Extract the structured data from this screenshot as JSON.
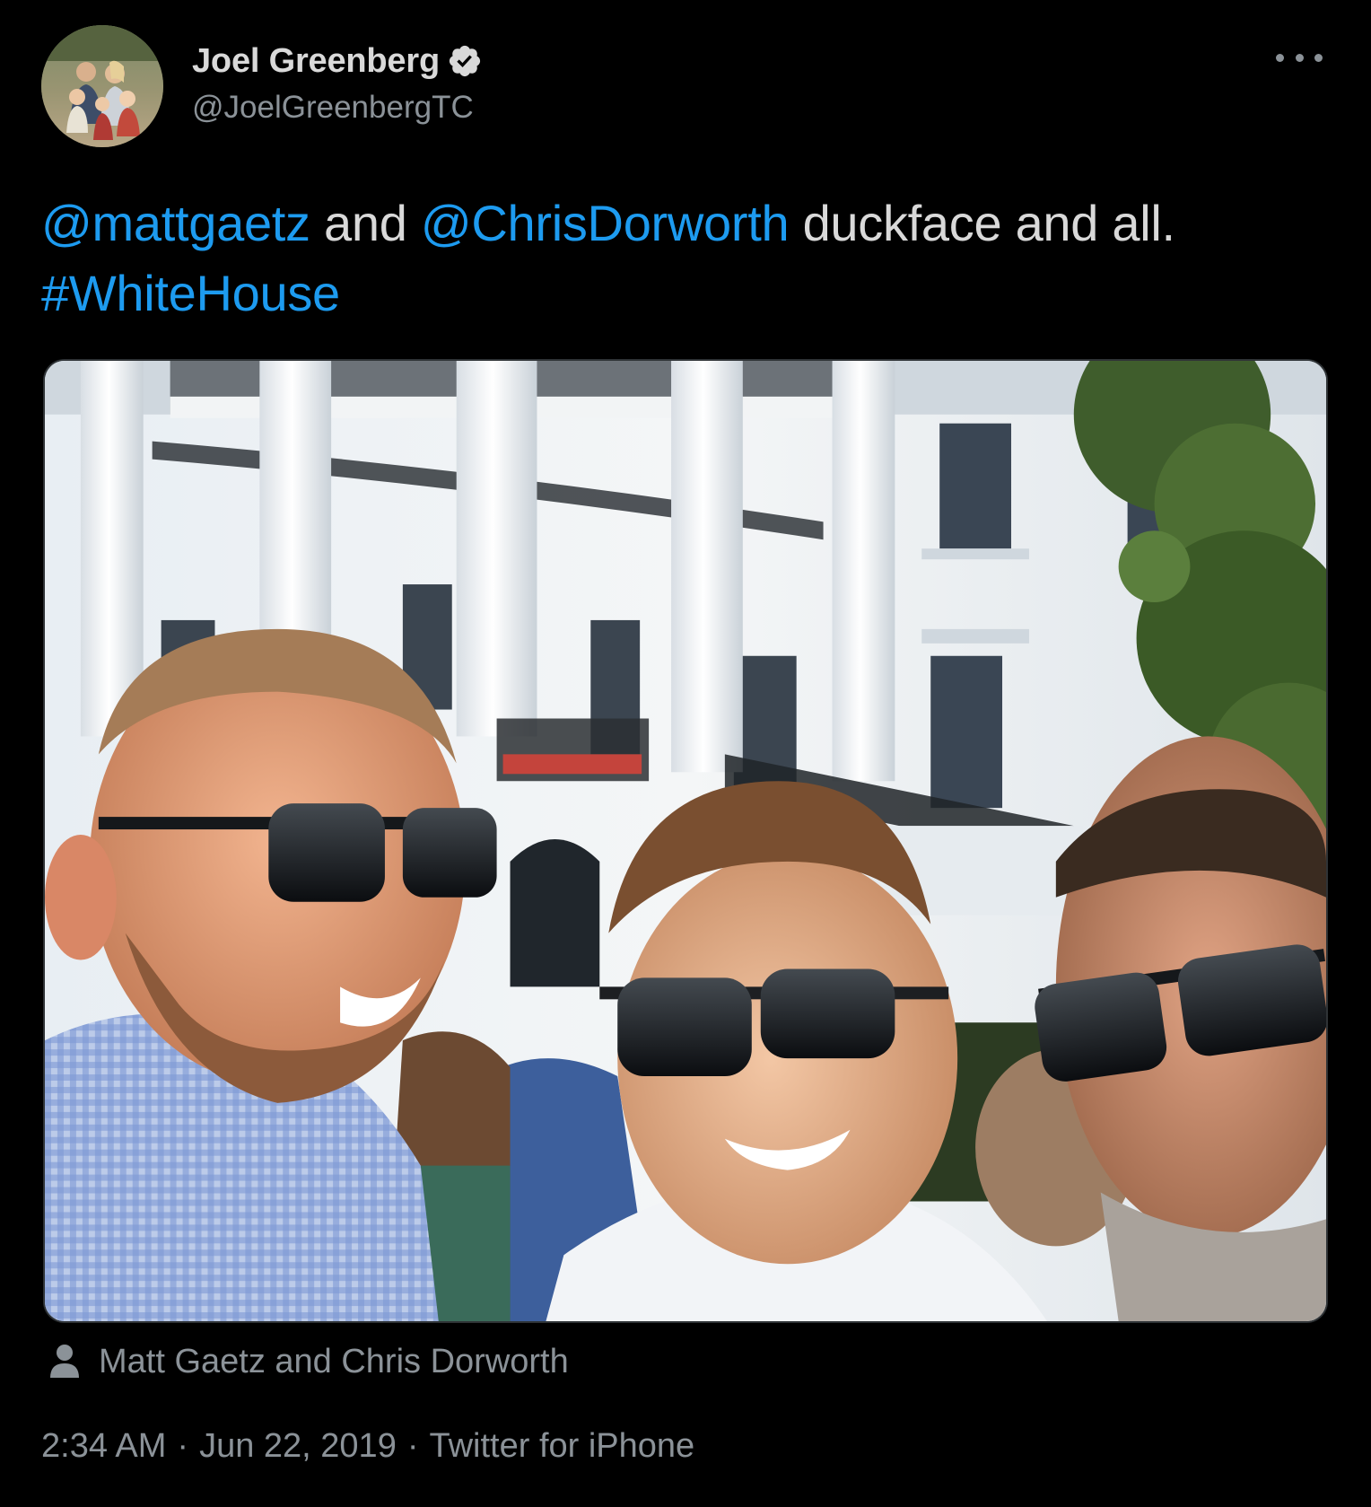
{
  "author": {
    "display_name": "Joel Greenberg",
    "handle": "@JoelGreenbergTC",
    "verified": true,
    "verified_icon": "verified-badge-icon",
    "avatar_icon": "profile-photo"
  },
  "menu": {
    "icon": "more-options-icon"
  },
  "tweet": {
    "segments": [
      {
        "text": "@mattgaetz",
        "type": "mention"
      },
      {
        "text": " and ",
        "type": "text"
      },
      {
        "text": "@ChrisDorworth",
        "type": "mention"
      },
      {
        "text": " duckface and all.",
        "type": "text"
      }
    ],
    "hashtag": "#WhiteHouse"
  },
  "media": {
    "tagged_people": "Matt Gaetz and Chris Dorworth",
    "tag_icon": "person-icon"
  },
  "meta": {
    "time": "2:34 AM",
    "separator": "·",
    "date": "Jun 22, 2019",
    "source": "Twitter for iPhone"
  },
  "colors": {
    "background": "#000000",
    "text": "#d9d9d9",
    "secondary": "#8b9298",
    "link": "#1d9bf0"
  }
}
